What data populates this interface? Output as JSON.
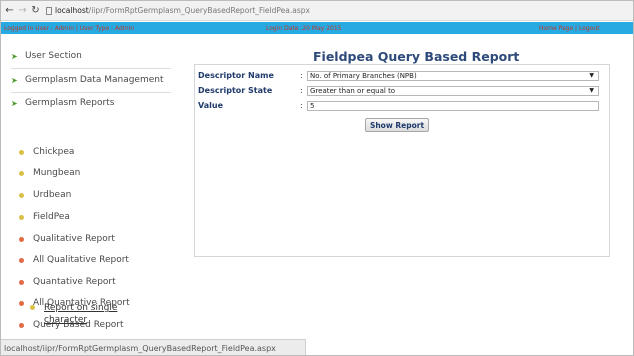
{
  "browser": {
    "url_host": "localhost",
    "url_path": "/iipr/FormRptGermplasm_QueryBasedReport_FieldPea.aspx"
  },
  "infobar": {
    "user_info": "Logged in User : Admin | User Type : Admin",
    "login_date": "Login Date :20 May 2015",
    "links": "Home Page | Logout"
  },
  "sidebar": {
    "user_section": "User Section",
    "germplasm_data_management": "Germplasm Data Management",
    "germplasm_reports": "Germplasm Reports",
    "crops": [
      "Chickpea",
      "Mungbean",
      "Urdbean",
      "FieldPea"
    ],
    "fieldpea_reports": [
      "Qualitative Report",
      "All Qualitative Report",
      "Quantative Report",
      "All Quantative Report",
      "Query Based Report"
    ],
    "query_sub_line1": "Report on single",
    "query_sub_line2": "character"
  },
  "main": {
    "title": "Fieldpea Query Based Report",
    "descriptor_name_label": "Descriptor Name",
    "descriptor_name_value": "No. of Primary Branches (NPB)",
    "descriptor_state_label": "Descriptor State",
    "descriptor_state_value": "Greater than or equal to",
    "value_label": "Value",
    "value_value": "5",
    "colon": ":",
    "show_report_button": "Show Report"
  },
  "statusbar": {
    "text": "localhost/iipr/FormRptGermplasm_QueryBasedReport_FieldPea.aspx"
  },
  "colors": {
    "infobar_bg": "#27a9e1",
    "infobar_text": "#c0392b",
    "title": "#2e4a7a",
    "label": "#1f3a6b",
    "arrow": "#4b9a2c",
    "crop_dot": "#d9c047",
    "report_dot": "#e06b45"
  },
  "icons": [
    "back-icon",
    "forward-icon",
    "reload-icon",
    "page-icon",
    "chevron-right-icon",
    "bullet-icon",
    "dropdown-caret-icon"
  ]
}
